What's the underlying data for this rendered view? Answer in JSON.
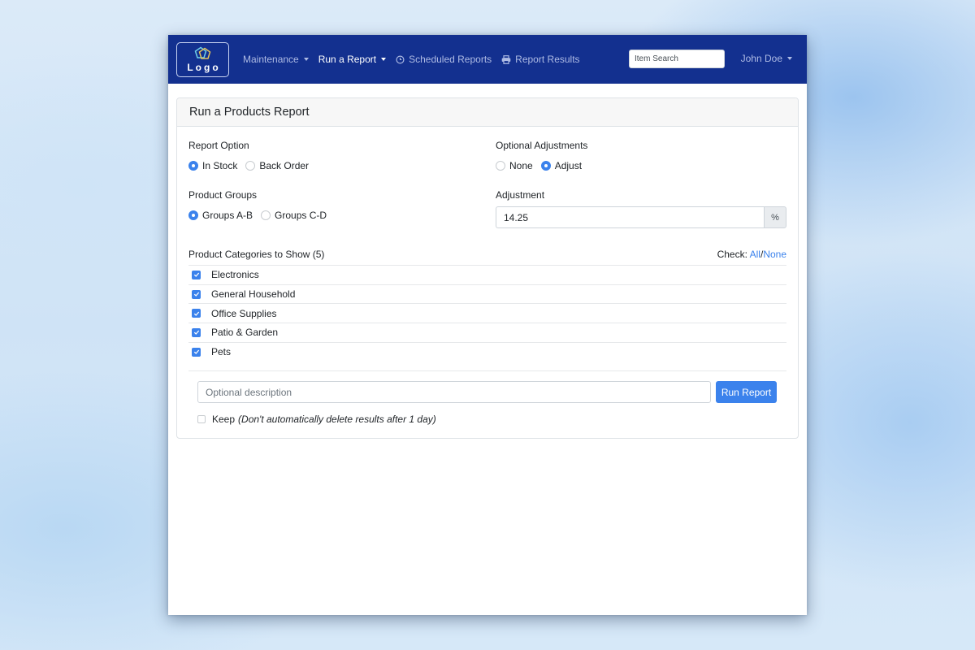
{
  "navbar": {
    "logo_text": "Logo",
    "items": [
      {
        "label": "Maintenance",
        "icon": "",
        "has_caret": true,
        "active": false
      },
      {
        "label": "Run a Report",
        "icon": "",
        "has_caret": true,
        "active": true
      },
      {
        "label": "Scheduled Reports",
        "icon": "clock-icon",
        "has_caret": false,
        "active": false
      },
      {
        "label": "Report Results",
        "icon": "printer-icon",
        "has_caret": false,
        "active": false
      }
    ],
    "search_placeholder": "Item Search",
    "user_name": "John Doe"
  },
  "card": {
    "title": "Run a Products Report",
    "report_option": {
      "label": "Report Option",
      "options": [
        "In Stock",
        "Back Order"
      ],
      "selected": "In Stock"
    },
    "product_groups": {
      "label": "Product Groups",
      "options": [
        "Groups A-B",
        "Groups C-D"
      ],
      "selected": "Groups A-B"
    },
    "optional_adjustments": {
      "label": "Optional Adjustments",
      "options": [
        "None",
        "Adjust"
      ],
      "selected": "Adjust"
    },
    "adjustment": {
      "label": "Adjustment",
      "value": "14.25",
      "unit": "%"
    },
    "categories": {
      "label": "Product Categories to Show (5)",
      "check_label": "Check:",
      "check_all": "All",
      "check_separator": "/",
      "check_none": "None",
      "items": [
        {
          "label": "Electronics",
          "checked": true
        },
        {
          "label": "General Household",
          "checked": true
        },
        {
          "label": "Office Supplies",
          "checked": true
        },
        {
          "label": "Patio & Garden",
          "checked": true
        },
        {
          "label": "Pets",
          "checked": true
        }
      ]
    },
    "description_placeholder": "Optional description",
    "description_value": "",
    "run_button": "Run Report",
    "keep": {
      "label": "Keep",
      "note": "(Don't automatically delete results after 1 day)",
      "checked": false
    }
  },
  "colors": {
    "navbar": "#13308f",
    "primary": "#3b82ec",
    "nav_text": "#aebbe4"
  }
}
